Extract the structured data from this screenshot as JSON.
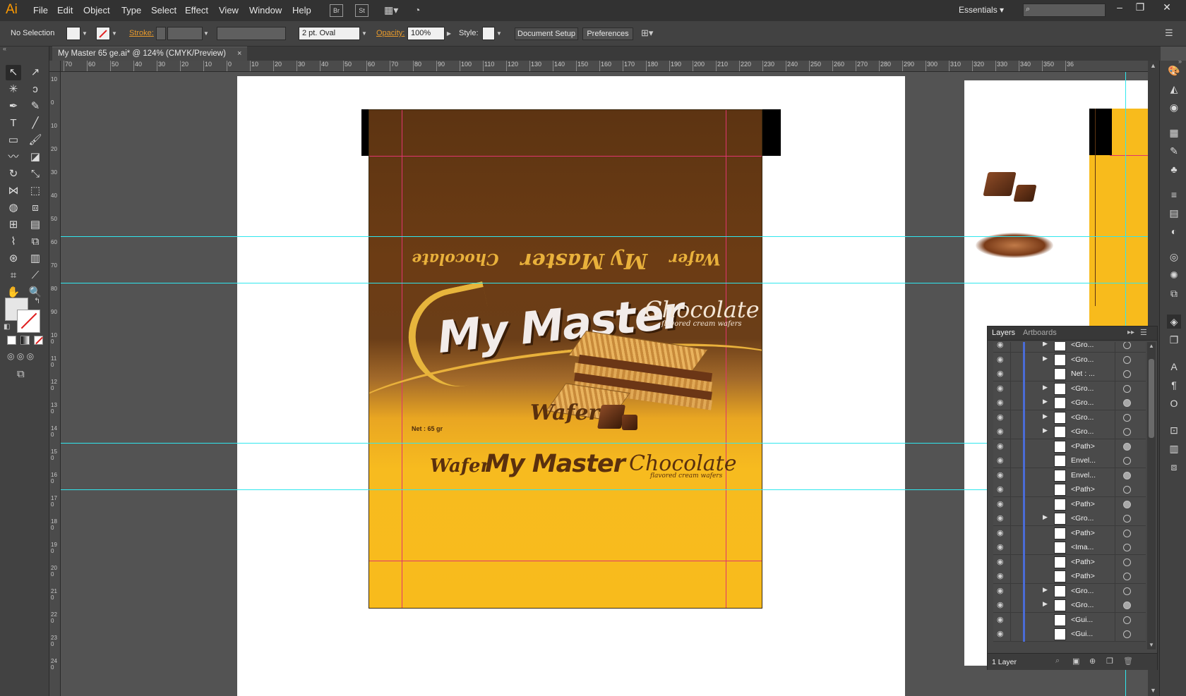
{
  "app": {
    "logo": "Ai"
  },
  "menu": {
    "items": [
      "File",
      "Edit",
      "Object",
      "Type",
      "Select",
      "Effect",
      "View",
      "Window",
      "Help"
    ],
    "bridge_label": "Br",
    "stock_label": "St",
    "workspace": "Essentials",
    "window_controls": [
      "–",
      "❐",
      "✕"
    ]
  },
  "control_bar": {
    "selection": "No Selection",
    "stroke_label": "Stroke:",
    "brush": "2 pt. Oval",
    "opacity_label": "Opacity:",
    "opacity_value": "100%",
    "style_label": "Style:",
    "document_setup": "Document Setup",
    "preferences": "Preferences"
  },
  "document": {
    "tab_title": "My Master 65 ge.ai* @ 124% (CMYK/Preview)",
    "close_glyph": "×"
  },
  "rulers": {
    "horizontal": [
      "70",
      "60",
      "50",
      "40",
      "30",
      "20",
      "10",
      "0",
      "10",
      "20",
      "30",
      "40",
      "50",
      "60",
      "70",
      "80",
      "90",
      "100",
      "110",
      "120",
      "130",
      "140",
      "150",
      "160",
      "170",
      "180",
      "190",
      "200",
      "210",
      "220",
      "230",
      "240",
      "250",
      "260",
      "270",
      "280",
      "290",
      "300",
      "310",
      "320",
      "330",
      "340",
      "350",
      "36"
    ],
    "vertical": [
      "10",
      "0",
      "10",
      "20",
      "30",
      "40",
      "50",
      "60",
      "70",
      "80",
      "90",
      "100",
      "110",
      "120",
      "130",
      "140",
      "150",
      "160",
      "170",
      "180",
      "190",
      "200",
      "210",
      "220",
      "230",
      "240"
    ]
  },
  "package": {
    "brand": "My Master",
    "flavor": "Chocolate",
    "flavor_sub": "flavored cream wafers",
    "product": "Wafer",
    "net_weight": "Net : 65 gr",
    "colors": {
      "brown": "#5d3412",
      "yellow": "#f8bb1c",
      "gold": "#e9b13b"
    }
  },
  "layers_panel": {
    "tabs": [
      "Layers",
      "Artboards"
    ],
    "footer": "1 Layer",
    "rows": [
      {
        "name": "<Gro...",
        "expand": true,
        "filled": false
      },
      {
        "name": "<Gro...",
        "expand": true,
        "filled": false
      },
      {
        "name": "Net : ...",
        "expand": false,
        "filled": false
      },
      {
        "name": "<Gro...",
        "expand": true,
        "filled": false
      },
      {
        "name": "<Gro...",
        "expand": true,
        "filled": true
      },
      {
        "name": "<Gro...",
        "expand": true,
        "filled": false
      },
      {
        "name": "<Gro...",
        "expand": true,
        "filled": false
      },
      {
        "name": "<Path>",
        "expand": false,
        "filled": true
      },
      {
        "name": "Envel...",
        "expand": false,
        "filled": false
      },
      {
        "name": "Envel...",
        "expand": false,
        "filled": true
      },
      {
        "name": "<Path>",
        "expand": false,
        "filled": false
      },
      {
        "name": "<Path>",
        "expand": false,
        "filled": true
      },
      {
        "name": "<Gro...",
        "expand": true,
        "filled": false
      },
      {
        "name": "<Path>",
        "expand": false,
        "filled": false
      },
      {
        "name": "<Ima...",
        "expand": false,
        "filled": false
      },
      {
        "name": "<Path>",
        "expand": false,
        "filled": false
      },
      {
        "name": "<Path>",
        "expand": false,
        "filled": false
      },
      {
        "name": "<Gro...",
        "expand": true,
        "filled": false
      },
      {
        "name": "<Gro...",
        "expand": true,
        "filled": true
      },
      {
        "name": "<Gui...",
        "expand": false,
        "filled": false
      },
      {
        "name": "<Gui...",
        "expand": false,
        "filled": false
      }
    ]
  }
}
